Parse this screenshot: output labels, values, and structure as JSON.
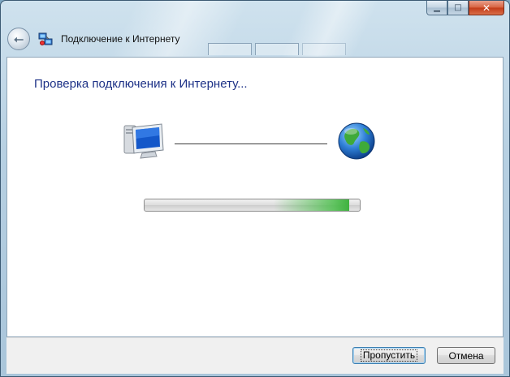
{
  "window": {
    "title": "Подключение к Интернету",
    "caption_buttons": {
      "minimize_icon": "minimize-icon",
      "maximize_icon": "maximize-icon",
      "close_icon": "close-icon"
    }
  },
  "wizard": {
    "heading": "Проверка подключения к Интернету...",
    "progress": {
      "fraction": 0.95,
      "color": "#3fb23f"
    },
    "icons": {
      "computer": "computer-icon",
      "globe": "globe-icon",
      "network": "network-connection-icon",
      "back": "back-arrow-icon"
    }
  },
  "footer": {
    "skip_label": "Пропустить",
    "cancel_label": "Отмена"
  },
  "colors": {
    "heading": "#1e3287",
    "frame": "#b7d0e2",
    "close_button": "#c23b18"
  }
}
